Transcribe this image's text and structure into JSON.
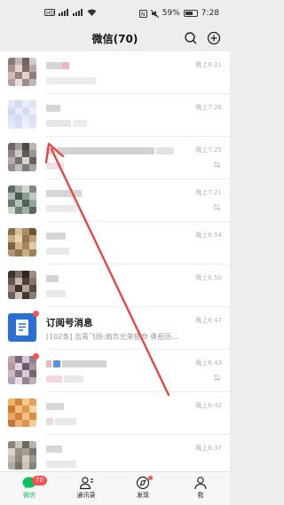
{
  "status_bar": {
    "left_icons": [
      "sim-icon",
      "signal-icon",
      "wifi-icon"
    ],
    "right_icons": [
      "nfc-icon",
      "mute-icon"
    ],
    "battery": "59%",
    "battery_level": 0.59,
    "time": "7:28"
  },
  "header": {
    "title": "微信(70)",
    "search_icon": "search-icon",
    "add_icon": "add-circle-icon"
  },
  "chats": [
    {
      "time": "晚上6:21",
      "muted": false
    },
    {
      "time": "晚上7:26",
      "muted": false
    },
    {
      "time": "晚上7:25",
      "muted": true
    },
    {
      "time": "晚上7:21",
      "muted": true
    },
    {
      "time": "晚上6:54",
      "muted": false
    },
    {
      "time": "晚上6:50",
      "muted": false
    },
    {
      "time": "晚上6:47",
      "muted": false,
      "name": "订阅号消息",
      "preview": "[102条] 吉青飞扬:肩负光荣使命 勇担历..."
    },
    {
      "time": "晚上6:43",
      "muted": true
    },
    {
      "time": "晚上6:42",
      "muted": false
    },
    {
      "time": "晚上6:37",
      "muted": false
    }
  ],
  "tabbar": {
    "tabs": [
      {
        "label": "微信",
        "icon": "chat-icon",
        "badge": "70",
        "active": true
      },
      {
        "label": "通讯录",
        "icon": "contacts-icon",
        "active": false
      },
      {
        "label": "发现",
        "icon": "compass-icon",
        "active": false
      },
      {
        "label": "我",
        "icon": "person-icon",
        "active": false
      }
    ]
  },
  "colors": {
    "accent": "#07c160",
    "badge": "#fa5151",
    "annotation_arrow": "#e8473f"
  }
}
